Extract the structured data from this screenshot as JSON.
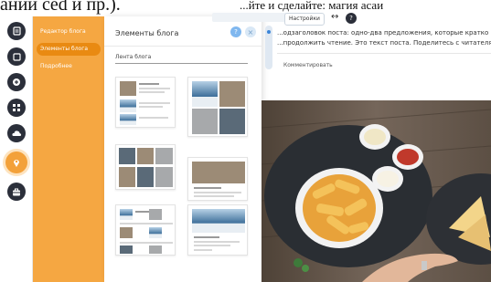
{
  "top_text": "ании ced и пр.).",
  "rail": {
    "icons": [
      "page-icon",
      "square-icon",
      "plus-circle-icon",
      "grid-add-icon",
      "cloud-upload-icon",
      "pin-icon",
      "briefcase-icon"
    ],
    "active_index": 5
  },
  "categories": {
    "items": [
      "Редактор блога",
      "Элементы блога",
      "Подробнее"
    ],
    "selected_index": 1
  },
  "elements_panel": {
    "title": "Элементы блога",
    "help_label": "?",
    "close_label": "×",
    "section_label": "Лента блога"
  },
  "blog": {
    "title": "...йте и сделайте: магия асаи",
    "settings_label": "Настройки",
    "move_glyph": "↔",
    "help_label": "?",
    "text_line1": "...одзаголовок поста: одно-два предложения, которые кратко пе",
    "text_line2": "...продолжить чтение. Это текст поста. Поделитесь с читателям",
    "comment_label": "Комментировать"
  },
  "colors": {
    "accent_orange": "#f5a742",
    "rail_dark": "#2b2f3a",
    "help_blue": "#7fb7ef"
  }
}
